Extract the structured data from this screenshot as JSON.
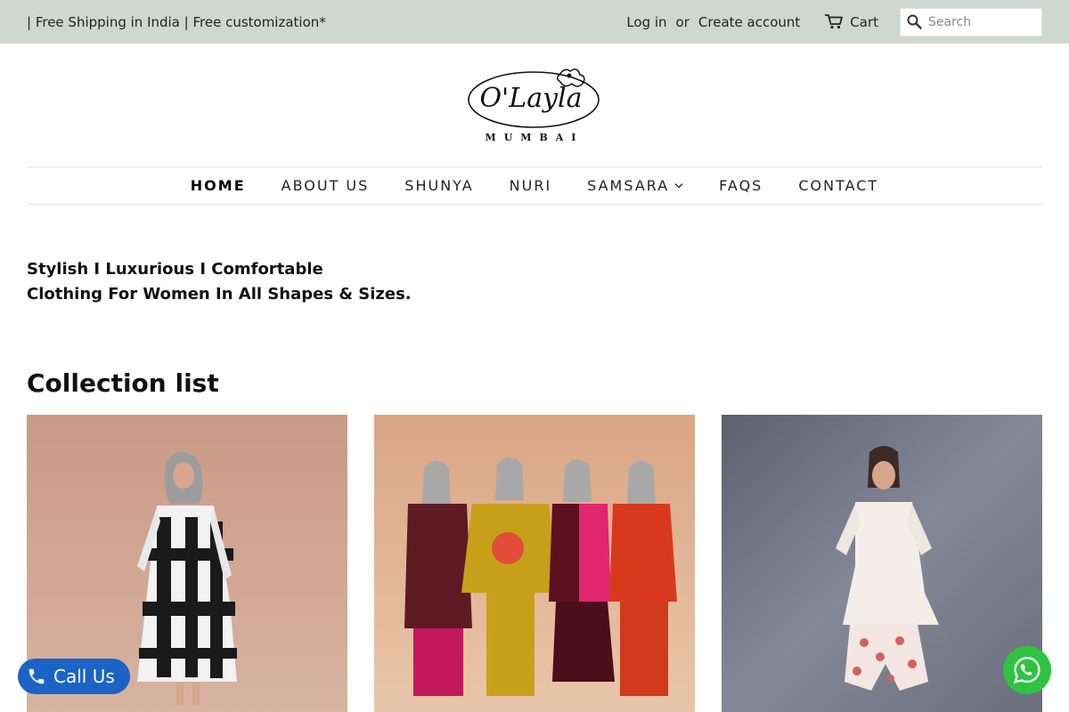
{
  "topbar": {
    "announcement": "| Free Shipping in India | Free customization*",
    "login": "Log in",
    "or": "or",
    "create_account": "Create account",
    "cart": "Cart",
    "search_placeholder": "Search",
    "background": "#ced7d2"
  },
  "logo": {
    "script_text": "O'Layla",
    "subtext": "MUMBAI"
  },
  "nav": {
    "items": [
      {
        "label": "HOME",
        "active": true
      },
      {
        "label": "ABOUT US"
      },
      {
        "label": "SHUNYA"
      },
      {
        "label": "NURI"
      },
      {
        "label": "SAMSARA",
        "has_dropdown": true
      },
      {
        "label": "FAQS"
      },
      {
        "label": "CONTACT"
      }
    ]
  },
  "hero": {
    "line1": "Stylish I Luxurious I Comfortable",
    "line2": "Clothing For Women In All Shapes & Sizes."
  },
  "collections": {
    "title": "Collection list"
  },
  "floating": {
    "call_label": "Call Us",
    "call_color": "#1b63c7",
    "whatsapp_color": "#2fc342"
  },
  "icons": [
    "search-icon",
    "cart-icon",
    "chevron-down-icon",
    "phone-icon",
    "whatsapp-icon"
  ]
}
